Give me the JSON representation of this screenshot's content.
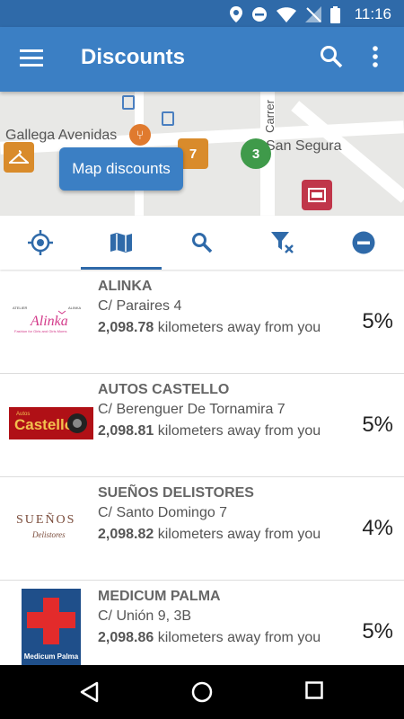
{
  "status_bar": {
    "time": "11:16"
  },
  "app_bar": {
    "title": "Discounts"
  },
  "map": {
    "street_labels": [
      "Gallega Avenidas",
      "Carrer",
      "San Segura"
    ],
    "cluster_count": "3",
    "map_discounts_button": "Map discounts"
  },
  "tabs": [
    {
      "name": "location",
      "icon": "crosshair-icon"
    },
    {
      "name": "map",
      "icon": "map-icon",
      "active": true
    },
    {
      "name": "search",
      "icon": "search-icon"
    },
    {
      "name": "clear-filter",
      "icon": "filter-clear-icon"
    },
    {
      "name": "remove",
      "icon": "minus-circle-icon"
    }
  ],
  "discounts": [
    {
      "name": "ALINKA",
      "address": "C/ Paraires 4",
      "distance": "2,098.78",
      "distance_suffix": " kilometers away from you",
      "percent": "5%",
      "logo": {
        "text": "Alinka",
        "sub": "Fashion for Girls and Girls Moms"
      }
    },
    {
      "name": "AUTOS CASTELLO",
      "address": "C/ Berenguer De Tornamira 7",
      "distance": "2,098.81",
      "distance_suffix": " kilometers away from you",
      "percent": "5%",
      "logo": {
        "text": "Castello",
        "sub": "Autos"
      }
    },
    {
      "name": "SUEÑOS DELISTORES",
      "address": "C/ Santo Domingo 7",
      "distance": "2,098.82",
      "distance_suffix": " kilometers away from you",
      "percent": "4%",
      "logo": {
        "text": "SUEÑOS",
        "sub": "Delistores"
      }
    },
    {
      "name": "MEDICUM PALMA",
      "address": "C/ Unión 9, 3B",
      "distance": "2,098.86",
      "distance_suffix": " kilometers away from you",
      "percent": "5%",
      "logo": {
        "text": "Medicum Palma",
        "sub": ""
      }
    }
  ],
  "colors": {
    "primary": "#3b7fc4",
    "primary_dark": "#2f6aa9",
    "pin_orange": "#d98b2b",
    "pin_green": "#3f9a4a",
    "pin_red": "#c0364a"
  }
}
